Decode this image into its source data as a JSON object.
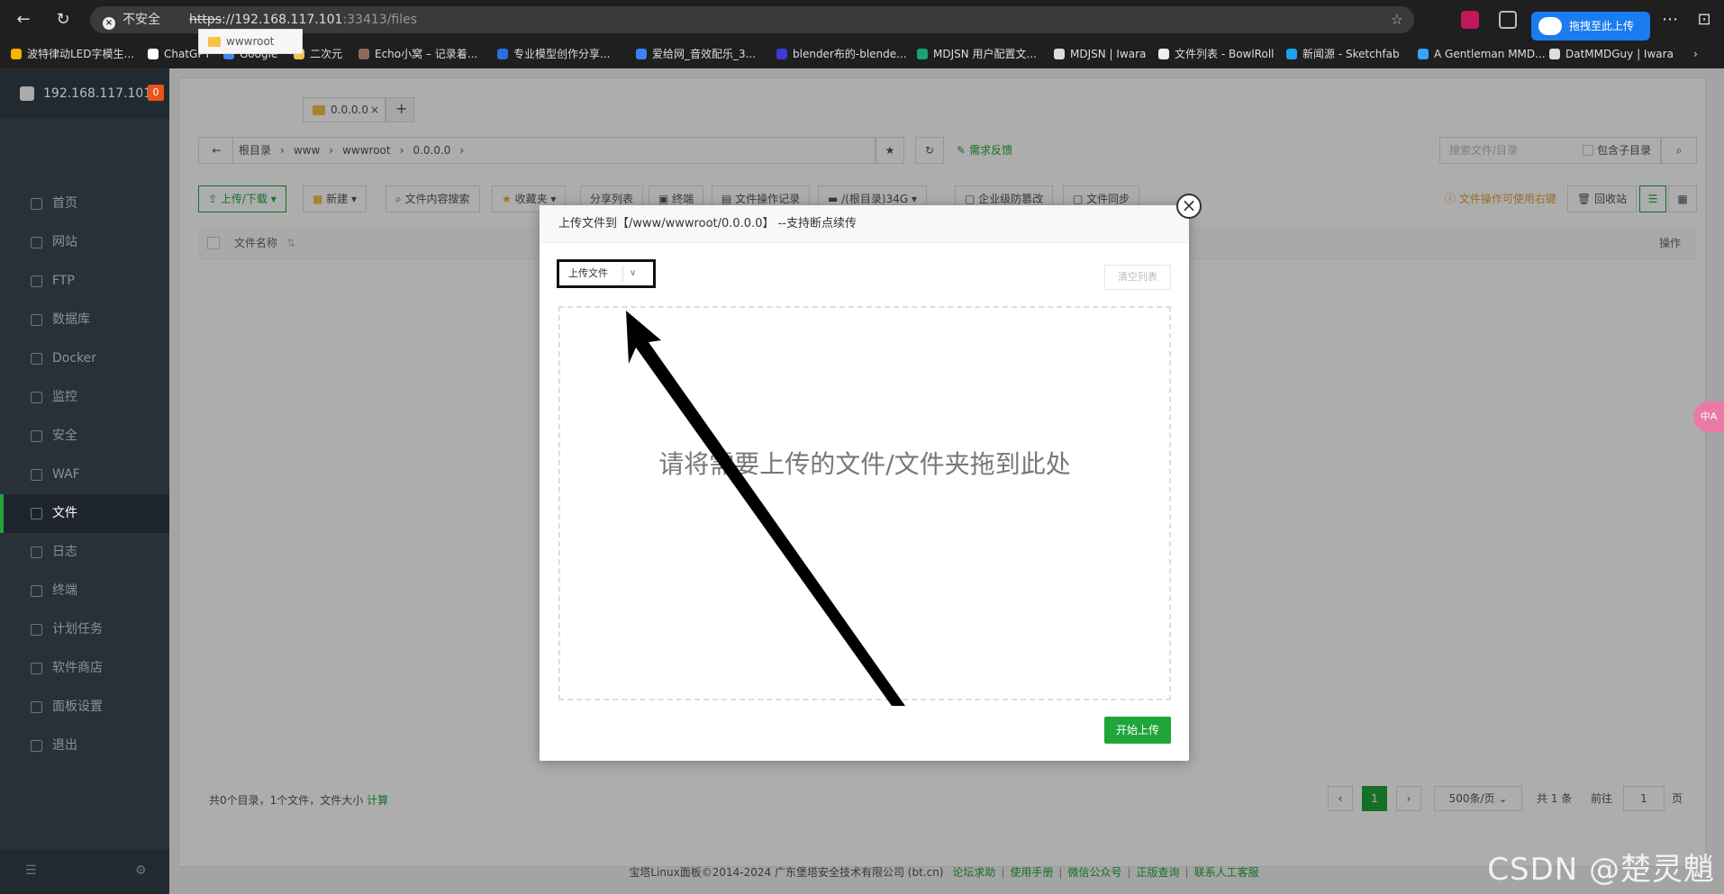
{
  "browser": {
    "security_label": "不安全",
    "url_scheme": "https",
    "url_rest": "://192.168.117.101",
    "url_path": ":33413/files",
    "extension_button": "拖拽至此上传"
  },
  "bookmarks": [
    {
      "label": "波特律动LED字模生...",
      "color": "#f4b400"
    },
    {
      "label": "ChatGPT",
      "color": "#ffffff"
    },
    {
      "label": "Google",
      "color": "#4285f4"
    },
    {
      "label": "二次元",
      "color": "#f5c344"
    },
    {
      "label": "Echo小窝 – 记录着...",
      "color": "#8a6a5a"
    },
    {
      "label": "专业模型创作分享...",
      "color": "#2d6cdf"
    },
    {
      "label": "爱给网_音效配乐_3...",
      "color": "#3b82f6"
    },
    {
      "label": "blender布的-blende...",
      "color": "#3b3bd6"
    },
    {
      "label": "MDJSN 用户配置文...",
      "color": "#1aa37a"
    },
    {
      "label": "MDJSN | Iwara",
      "color": "#dddddd"
    },
    {
      "label": "文件列表 - BowlRoll",
      "color": "#eeeeee"
    },
    {
      "label": "新闻源 - Sketchfab",
      "color": "#1ca3ec"
    },
    {
      "label": "A Gentleman MMD...",
      "color": "#3aa0ff"
    },
    {
      "label": "DatMMDGuy | Iwara",
      "color": "#dddddd"
    }
  ],
  "sidebar": {
    "server": "192.168.117.101",
    "badge": "0",
    "items": [
      {
        "label": "首页"
      },
      {
        "label": "网站"
      },
      {
        "label": "FTP"
      },
      {
        "label": "数据库"
      },
      {
        "label": "Docker"
      },
      {
        "label": "监控"
      },
      {
        "label": "安全"
      },
      {
        "label": "WAF"
      },
      {
        "label": "文件"
      },
      {
        "label": "日志"
      },
      {
        "label": "终端"
      },
      {
        "label": "计划任务"
      },
      {
        "label": "软件商店"
      },
      {
        "label": "面板设置"
      },
      {
        "label": "退出"
      }
    ],
    "active_index": 8
  },
  "tabs": [
    {
      "label": "wwwroot"
    },
    {
      "label": "0.0.0.0"
    }
  ],
  "crumbs": [
    "根目录",
    "www",
    "wwwroot",
    "0.0.0.0"
  ],
  "feedback": "需求反馈",
  "search": {
    "placeholder": "搜索文件/目录",
    "subdir": "包含子目录"
  },
  "toolbar": {
    "upload": "上传/下载",
    "new": "新建",
    "content_search": "文件内容搜索",
    "favorites": "收藏夹",
    "share": "分享列表",
    "terminal": "终端",
    "ops_log": "文件操作记录",
    "disk": "/(根目录)34G",
    "tamper": "企业级防篡改",
    "sync": "文件同步",
    "tip": "文件操作可使用右键",
    "recycle": "回收站"
  },
  "table": {
    "col_name": "文件名称",
    "col_action": "操作"
  },
  "status": {
    "summary": "共0个目录，1个文件，文件大小",
    "calc": "计算"
  },
  "pager": {
    "current": "1",
    "per_page": "500条/页",
    "total": "共 1 条",
    "goto": "前往",
    "page_input": "1",
    "page_unit": "页"
  },
  "footer": {
    "copyright": "宝塔Linux面板©2014-2024 广东堡塔安全技术有限公司 (bt.cn)",
    "links": [
      "论坛求助",
      "使用手册",
      "微信公众号",
      "正版查询",
      "联系人工客服"
    ]
  },
  "modal": {
    "title": "上传文件到【/www/wwwroot/0.0.0.0】 --支持断点续传",
    "close": "×",
    "upload_select": "上传文件",
    "clear": "清空列表",
    "drop_hint": "请将需要上传的文件/文件夹拖到此处",
    "start": "开始上传"
  },
  "watermark": "CSDN @楚灵魈",
  "translate_fab": "中A"
}
